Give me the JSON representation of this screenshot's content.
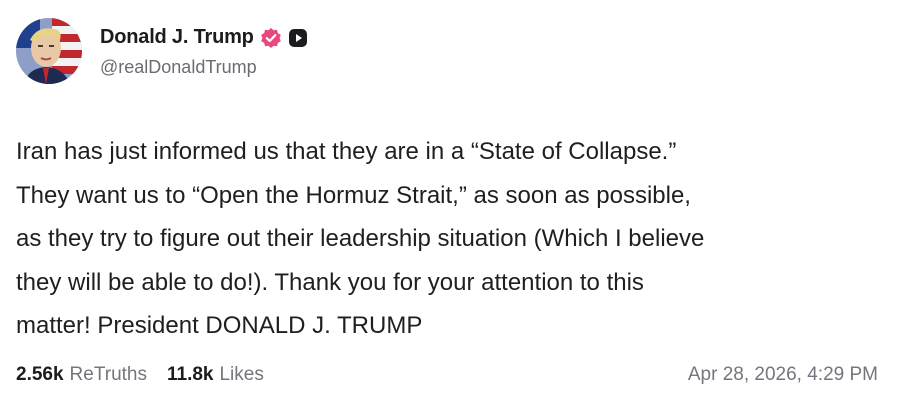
{
  "author": {
    "display_name": "Donald J. Trump",
    "handle": "@realDonaldTrump",
    "avatar_icon": "portrait-avatar",
    "verified_icon": "verified-badge-icon",
    "verified_color": "#e8497d",
    "media_icon": "media-badge-icon"
  },
  "post": {
    "text": "Iran has just informed us that they are in a “State of Collapse.”\nThey want us to “Open the Hormuz Strait,” as soon as possible,\nas they try to figure out their leadership situation (Which I believe\nthey will be able to do!). Thank you for your attention to this\nmatter! President DONALD J. TRUMP"
  },
  "stats": {
    "retruths_count": "2.56k",
    "retruths_label": "ReTruths",
    "likes_count": "11.8k",
    "likes_label": "Likes"
  },
  "timestamp": "Apr 28, 2026, 4:29 PM"
}
